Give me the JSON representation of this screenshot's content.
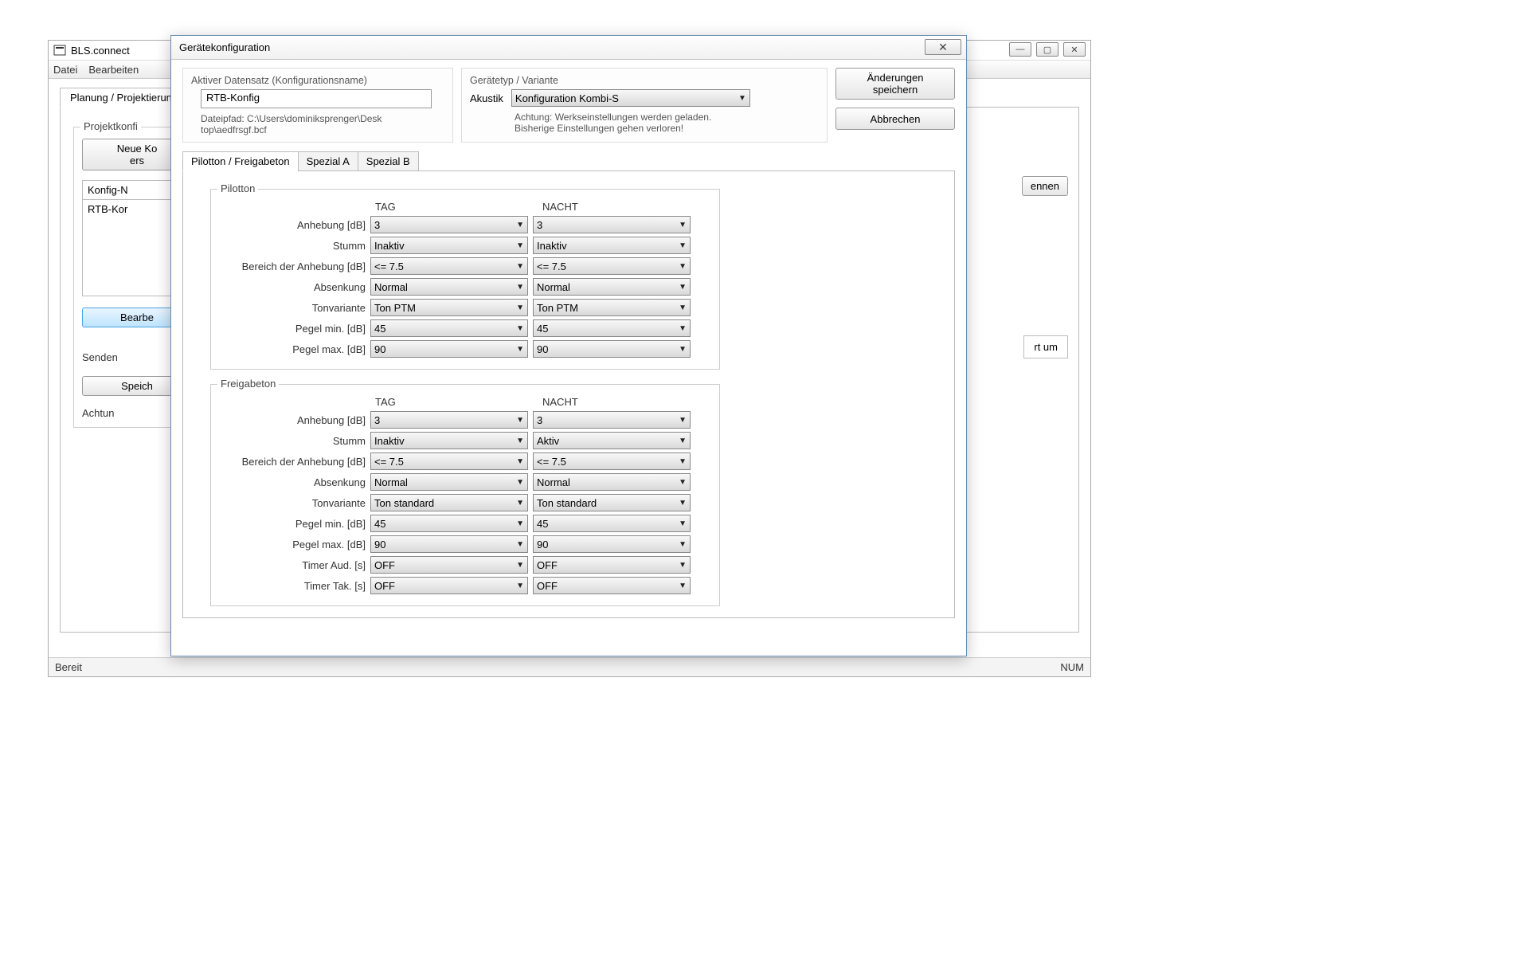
{
  "app": {
    "title": "BLS.connect"
  },
  "menu": {
    "file": "Datei",
    "edit": "Bearbeiten"
  },
  "outerTab": "Planung / Projektierung",
  "project": {
    "group": "Projektkonfi",
    "newBtn": "Neue Ko\ners",
    "cfgN": "Konfig-N",
    "cfgVal": "RTB-Kor",
    "editBtn": "Bearbe",
    "sendBtn": "Senden",
    "speichBtn": "Speich",
    "achtun": "Achtun"
  },
  "background": {
    "ennen": "ennen",
    "rtum": "rt um"
  },
  "dialog": {
    "title": "Gerätekonfiguration",
    "aktiver": "Aktiver Datensatz (Konfigurationsname)",
    "cfgName": "RTB-Konfig",
    "pathLabel": "Dateipfad: C:\\Users\\dominiksprenger\\Desk\ntop\\aedfrsgf.bcf",
    "devtype": "Gerätetyp / Variante",
    "akustik": "Akustik",
    "variant": "Konfiguration Kombi-S",
    "warn": "Achtung: Werkseinstellungen werden geladen.\nBisherige Einstellungen gehen verloren!",
    "saveBtn": "Änderungen\nspeichern",
    "cancelBtn": "Abbrechen"
  },
  "subtabs": {
    "t1": "Pilotton / Freigabeton",
    "t2": "Spezial A",
    "t3": "Spezial B"
  },
  "columns": {
    "day": "TAG",
    "night": "NACHT"
  },
  "pilotton": {
    "legend": "Pilotton",
    "rows": [
      {
        "label": "Anhebung [dB]",
        "day": "3",
        "night": "3"
      },
      {
        "label": "Stumm",
        "day": "Inaktiv",
        "night": "Inaktiv"
      },
      {
        "label": "Bereich der Anhebung [dB]",
        "day": "<= 7.5",
        "night": "<= 7.5"
      },
      {
        "label": "Absenkung",
        "day": "Normal",
        "night": "Normal"
      },
      {
        "label": "Tonvariante",
        "day": "Ton PTM",
        "night": "Ton PTM"
      },
      {
        "label": "Pegel min. [dB]",
        "day": "45",
        "night": "45"
      },
      {
        "label": "Pegel max. [dB]",
        "day": "90",
        "night": "90"
      }
    ]
  },
  "freigabeton": {
    "legend": "Freigabeton",
    "rows": [
      {
        "label": "Anhebung [dB]",
        "day": "3",
        "night": "3"
      },
      {
        "label": "Stumm",
        "day": "Inaktiv",
        "night": "Aktiv"
      },
      {
        "label": "Bereich der Anhebung [dB]",
        "day": "<= 7.5",
        "night": "<= 7.5"
      },
      {
        "label": "Absenkung",
        "day": "Normal",
        "night": "Normal"
      },
      {
        "label": "Tonvariante",
        "day": "Ton standard",
        "night": "Ton standard"
      },
      {
        "label": "Pegel min. [dB]",
        "day": "45",
        "night": "45"
      },
      {
        "label": "Pegel max. [dB]",
        "day": "90",
        "night": "90"
      },
      {
        "label": "Timer Aud. [s]",
        "day": "OFF",
        "night": "OFF"
      },
      {
        "label": "Timer Tak. [s]",
        "day": "OFF",
        "night": "OFF"
      }
    ]
  },
  "status": {
    "ready": "Bereit",
    "num": "NUM"
  }
}
